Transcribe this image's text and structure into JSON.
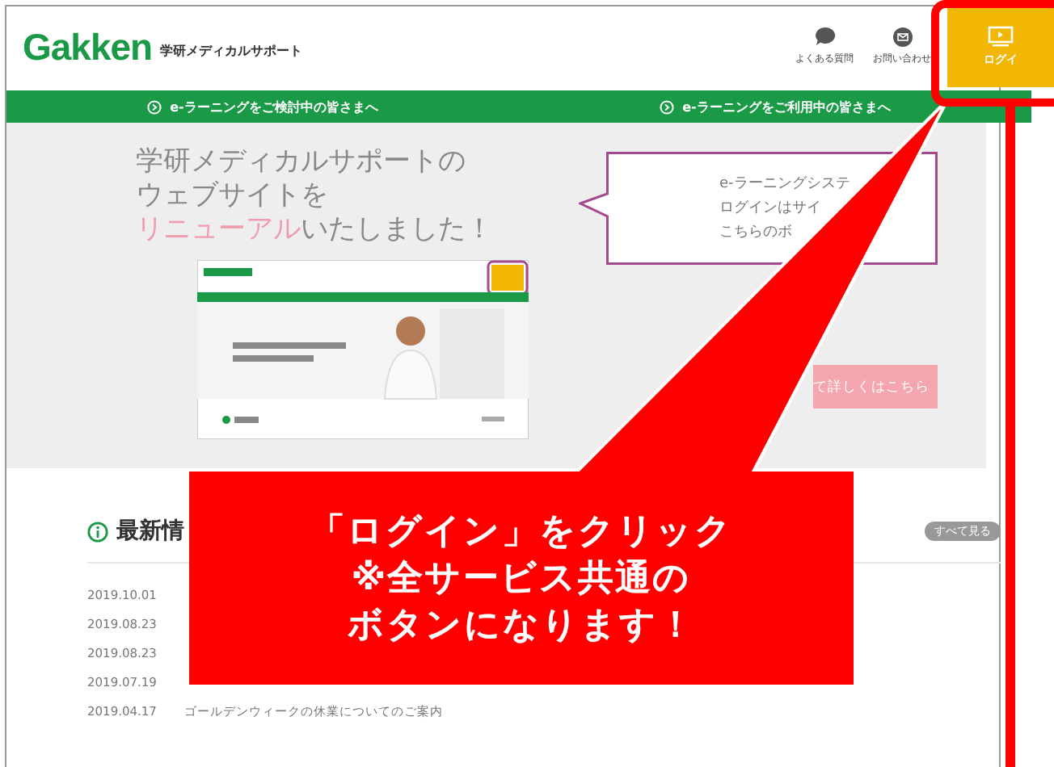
{
  "header": {
    "logo": "Gakken",
    "subtitle": "学研メディカルサポート",
    "links": [
      {
        "kind": "faq",
        "label": "よくある質問"
      },
      {
        "kind": "mail",
        "label": "お問い合わせ"
      }
    ],
    "login": {
      "label": "ログイ"
    }
  },
  "nav": [
    {
      "label": "e-ラーニングをご検討中の皆さまへ"
    },
    {
      "label": "e-ラーニングをご利用中の皆さまへ"
    }
  ],
  "hero": {
    "heading": [
      "学研メディカルサポートの",
      "ウェブサイトを"
    ],
    "heading_highlight": "リニューアル",
    "heading_rest": "いたしました！",
    "preview": {
      "kind": "picture"
    },
    "bubble": [
      "e-ラーニングシステ",
      "ログインはサイ",
      "こちらのボ"
    ],
    "button": "て詳しくはこちら"
  },
  "news": {
    "title": "最新情",
    "more": "すべて見る",
    "items": [
      {
        "date": "2019.10.01"
      },
      {
        "date": "2019.08.23"
      },
      {
        "date": "2019.08.23"
      },
      {
        "date": "2019.07.19"
      },
      {
        "date": "2019.04.17",
        "title": "ゴールデンウィークの休業についてのご案内"
      }
    ]
  },
  "callout": {
    "lines": [
      "「ログイン」をクリック",
      "※全サービス共通の",
      "ボタンになります！"
    ]
  }
}
